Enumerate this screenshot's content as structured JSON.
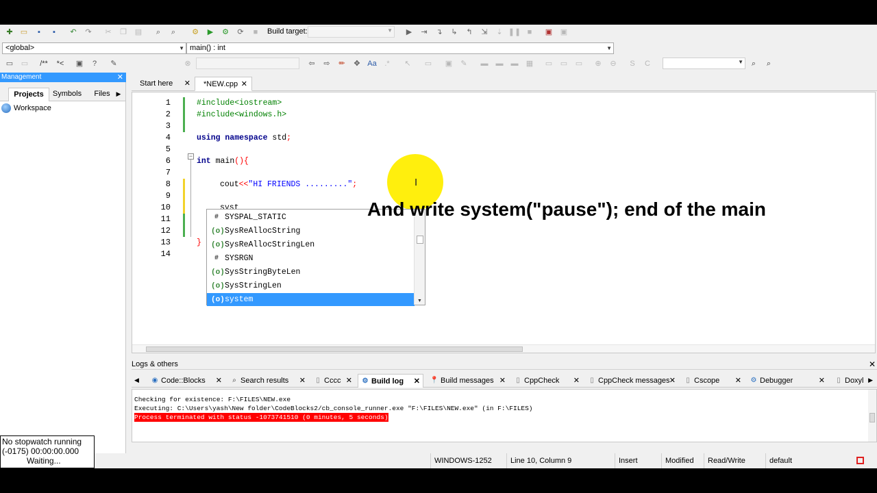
{
  "toolbar": {
    "build_target_label": "Build target:",
    "build_target_value": ""
  },
  "navigation": {
    "scope": "<global>",
    "function": "main() : int"
  },
  "management": {
    "title": "Management",
    "tabs": [
      "Projects",
      "Symbols",
      "Files"
    ],
    "tree_root": "Workspace"
  },
  "editor": {
    "tabs": [
      {
        "label": "Start here"
      },
      {
        "label": "*NEW.cpp"
      }
    ],
    "line_numbers": [
      "1",
      "2",
      "3",
      "4",
      "5",
      "6",
      "7",
      "8",
      "9",
      "10",
      "11",
      "12",
      "13",
      "14"
    ],
    "lines": [
      {
        "pp": "#include<iostream>"
      },
      {
        "pp": "#include<windows.h>"
      },
      {},
      {
        "kw1": "using namespace",
        "plain": " std",
        "op": ";"
      },
      {},
      {
        "kw1": "int",
        "plain": " main",
        "op": "(){"
      },
      {},
      {
        "plain": "cout",
        "op": "<<",
        "str": "\"HI FRIENDS .........\"",
        "op2": ";"
      },
      {},
      {
        "plain": "syst"
      },
      {},
      {},
      {
        "op": "}"
      },
      {}
    ]
  },
  "autocomplete": {
    "items": [
      {
        "icon": "#",
        "label": "SYSPAL_STATIC"
      },
      {
        "icon": "(o)",
        "label": "SysReAllocString"
      },
      {
        "icon": "(o)",
        "label": "SysReAllocStringLen"
      },
      {
        "icon": "#",
        "label": "SYSRGN"
      },
      {
        "icon": "(o)",
        "label": "SysStringByteLen"
      },
      {
        "icon": "(o)",
        "label": "SysStringLen"
      },
      {
        "icon": "(o)",
        "label": "system"
      }
    ],
    "selected_index": 6
  },
  "overlay": {
    "caption": "And write system(\"pause\"); end of the main"
  },
  "stopwatch": {
    "line1": "No stopwatch running",
    "line2": "(-0175)  00:00:00.000",
    "line3": "Waiting..."
  },
  "logs": {
    "title": "Logs & others",
    "tabs": [
      {
        "label": "Code::Blocks",
        "icon": "cb"
      },
      {
        "label": "Search results",
        "icon": "search"
      },
      {
        "label": "Cccc",
        "icon": "doc"
      },
      {
        "label": "Build log",
        "icon": "gear"
      },
      {
        "label": "Build messages",
        "icon": "pin"
      },
      {
        "label": "CppCheck",
        "icon": "doc"
      },
      {
        "label": "CppCheck messages",
        "icon": "doc"
      },
      {
        "label": "Cscope",
        "icon": "doc"
      },
      {
        "label": "Debugger",
        "icon": "gear"
      },
      {
        "label": "Doxyl",
        "icon": "doc"
      }
    ],
    "active_tab": "Build log",
    "lines": [
      "Checking for existence: F:\\FILES\\NEW.exe",
      "Executing: C:\\Users\\yash\\New folder\\CodeBlocks2/cb_console_runner.exe \"F:\\FILES\\NEW.exe\" (in F:\\FILES)",
      "Process terminated with status -1073741510 (0 minutes, 5 seconds)"
    ]
  },
  "statusbar": {
    "encoding": "WINDOWS-1252",
    "position": "Line 10, Column 9",
    "mode": "Insert",
    "modified": "Modified",
    "access": "Read/Write",
    "profile": "default"
  },
  "colors": {
    "accent": "#3399ff",
    "error": "#ff0000",
    "highlight": "#ffee00"
  }
}
